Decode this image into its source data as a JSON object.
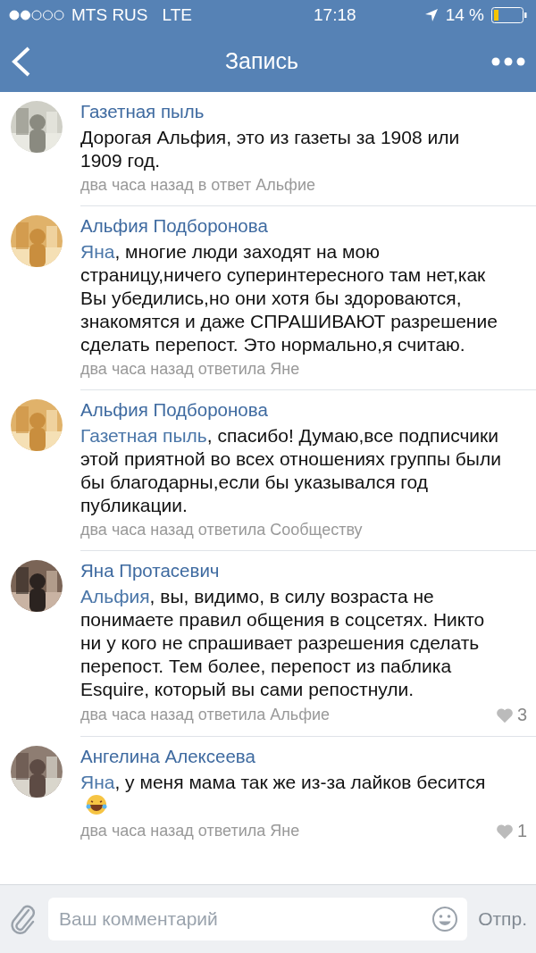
{
  "status_bar": {
    "carrier": "MTS RUS",
    "network": "LTE",
    "time": "17:18",
    "battery": "14 %"
  },
  "nav": {
    "title": "Запись"
  },
  "comments": [
    {
      "author": "Газетная пыль",
      "text": "Дорогая Альфия, это из газеты за 1908 или 1909 год.",
      "meta": "два часа назад в ответ Альфие"
    },
    {
      "author": "Альфия Подборонова",
      "mention": "Яна",
      "text": ", многие люди заходят на мою страницу,ничего суперинтересного там нет,как Вы убедились,но они хотя бы здороваются, знакомятся и даже СПРАШИВАЮТ разрешение сделать перепост. Это нормально,я считаю.",
      "meta": "два часа назад ответила Яне"
    },
    {
      "author": "Альфия Подборонова",
      "mention": "Газетная пыль",
      "text": ", спасибо! Думаю,все подписчики этой приятной во всех отношениях группы были бы благодарны,если бы указывался год публикации.",
      "meta": "два часа назад ответила Сообществу"
    },
    {
      "author": "Яна Протасевич",
      "mention": "Альфия",
      "text": ", вы, видимо, в силу возраста не понимаете правил общения в соцсетях. Никто ни у кого не спрашивает разрешения сделать перепост. Тем более, перепост из паблика Esquire, который вы сами репостнули.",
      "meta": "два часа назад ответила Альфие",
      "likes": "3"
    },
    {
      "author": "Ангелина Алексеева",
      "mention": "Яна",
      "text": ", у меня мама так же из-за лайков бесится",
      "emoji": true,
      "meta": "два часа назад ответила Яне",
      "likes": "1"
    }
  ],
  "composer": {
    "placeholder": "Ваш комментарий",
    "send": "Отпр."
  }
}
